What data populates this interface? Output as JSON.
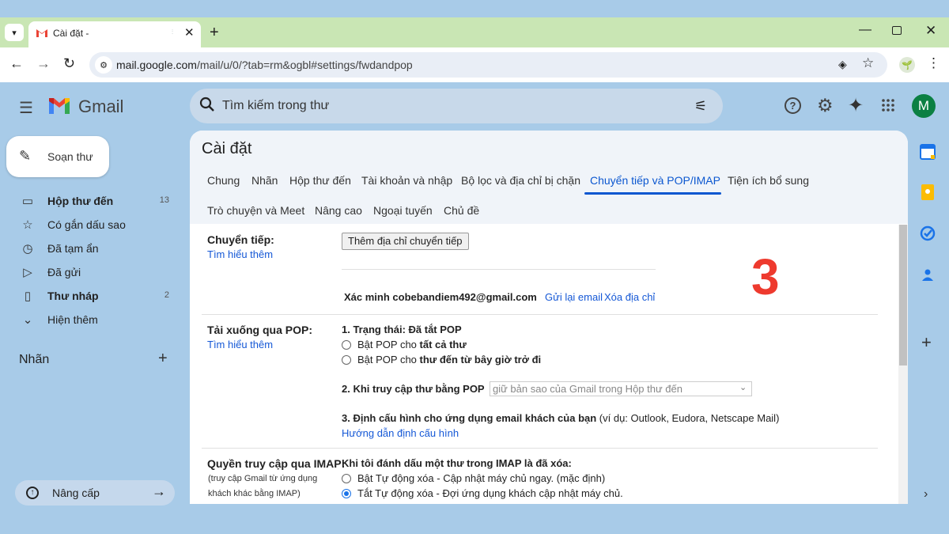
{
  "browser": {
    "tab_title": "Cài đặt -",
    "url_host": "mail.google.com",
    "url_path": "/mail/u/0/?tab=rm&ogbl#settings/fwdandpop"
  },
  "gmail": {
    "product_name": "Gmail",
    "search_placeholder": "Tìm kiếm trong thư",
    "avatar_letter": "M",
    "compose_label": "Soạn thư"
  },
  "sidebar": {
    "items": [
      {
        "label": "Hộp thư đến",
        "count": "13",
        "bold": true,
        "icon": "inbox-icon"
      },
      {
        "label": "Có gắn dấu sao",
        "count": "",
        "bold": false,
        "icon": "star-icon"
      },
      {
        "label": "Đã tạm ẩn",
        "count": "",
        "bold": false,
        "icon": "clock-icon"
      },
      {
        "label": "Đã gửi",
        "count": "",
        "bold": false,
        "icon": "send-icon"
      },
      {
        "label": "Thư nháp",
        "count": "2",
        "bold": true,
        "icon": "draft-icon"
      },
      {
        "label": "Hiện thêm",
        "count": "",
        "bold": false,
        "icon": "chevron-down-icon"
      }
    ],
    "labels_heading": "Nhãn",
    "upgrade_label": "Nâng cấp"
  },
  "settings": {
    "title": "Cài đặt",
    "tabs_row1": [
      "Chung",
      "Nhãn",
      "Hộp thư đến",
      "Tài khoản và nhập",
      "Bộ lọc và địa chỉ bị chặn",
      "Chuyển tiếp và POP/IMAP",
      "Tiện ích bổ sung"
    ],
    "tabs_row2": [
      "Trò chuyện và Meet",
      "Nâng cao",
      "Ngoại tuyến",
      "Chủ đề"
    ],
    "active_tab": "Chuyển tiếp và POP/IMAP",
    "forwarding": {
      "label": "Chuyển tiếp:",
      "learn_more": "Tìm hiểu thêm",
      "add_button": "Thêm địa chỉ chuyển tiếp",
      "verify_text": "Xác minh cobebandiem492@gmail.com",
      "resend_link": "Gửi lại email",
      "remove_link": "Xóa địa chỉ"
    },
    "pop": {
      "label": "Tải xuống qua POP:",
      "learn_more": "Tìm hiểu thêm",
      "status": "1. Trạng thái: Đã tắt POP",
      "option_all_prefix": "Bật POP cho ",
      "option_all_bold": "tất cả thư",
      "option_now_prefix": "Bật POP cho ",
      "option_now_bold": "thư đến từ bây giờ trở đi",
      "access_label": "2. Khi truy cập thư bằng POP",
      "access_select": "giữ bản sao của Gmail trong Hộp thư đến",
      "config_bold": "3. Định cấu hình cho ứng dụng email khách của bạn",
      "config_rest": " (ví dụ: Outlook, Eudora, Netscape Mail)",
      "config_link": "Hướng dẫn định cấu hình"
    },
    "imap": {
      "label": "Quyền truy cập qua IMAP:",
      "sub1": "(truy cập Gmail từ ứng dụng",
      "sub2": "khách khác bằng IMAP)",
      "heading": "Khi tôi đánh dấu một thư trong IMAP là đã xóa:",
      "option_on": "Bật Tự động xóa - Cập nhật máy chủ ngay. (mặc định)",
      "option_off": "Tắt Tự động xóa - Đợi ứng dụng khách cập nhật máy chủ.",
      "selected": "off"
    }
  },
  "annotation_number": "3",
  "colors": {
    "accent": "#0b57d0",
    "annotation": "#ee3a2e",
    "avatar": "#0b8043",
    "page_bg": "#a8cbe8"
  }
}
